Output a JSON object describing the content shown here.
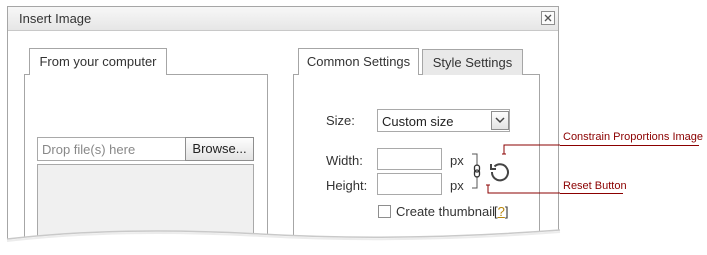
{
  "dialog": {
    "title": "Insert Image",
    "close_icon": "close-icon"
  },
  "left_panel": {
    "tab_label": "From your computer",
    "drop_placeholder": "Drop file(s) here",
    "browse_label": "Browse..."
  },
  "right_panel": {
    "tabs": [
      {
        "label": "Common Settings",
        "active": true
      },
      {
        "label": "Style Settings",
        "active": false
      }
    ],
    "size_label": "Size:",
    "size_value": "Custom size",
    "width_label": "Width:",
    "height_label": "Height:",
    "width_value": "",
    "height_value": "",
    "width_unit": "px",
    "height_unit": "px",
    "thumbnail_label": "Create thumbnail",
    "help_link": "?",
    "thumbnail_checked": false
  },
  "annotations": {
    "constrain": "Constrain Proportions Image",
    "reset": "Reset Button"
  },
  "colors": {
    "annotation": "#8b0000",
    "border": "#a6a6a6"
  }
}
